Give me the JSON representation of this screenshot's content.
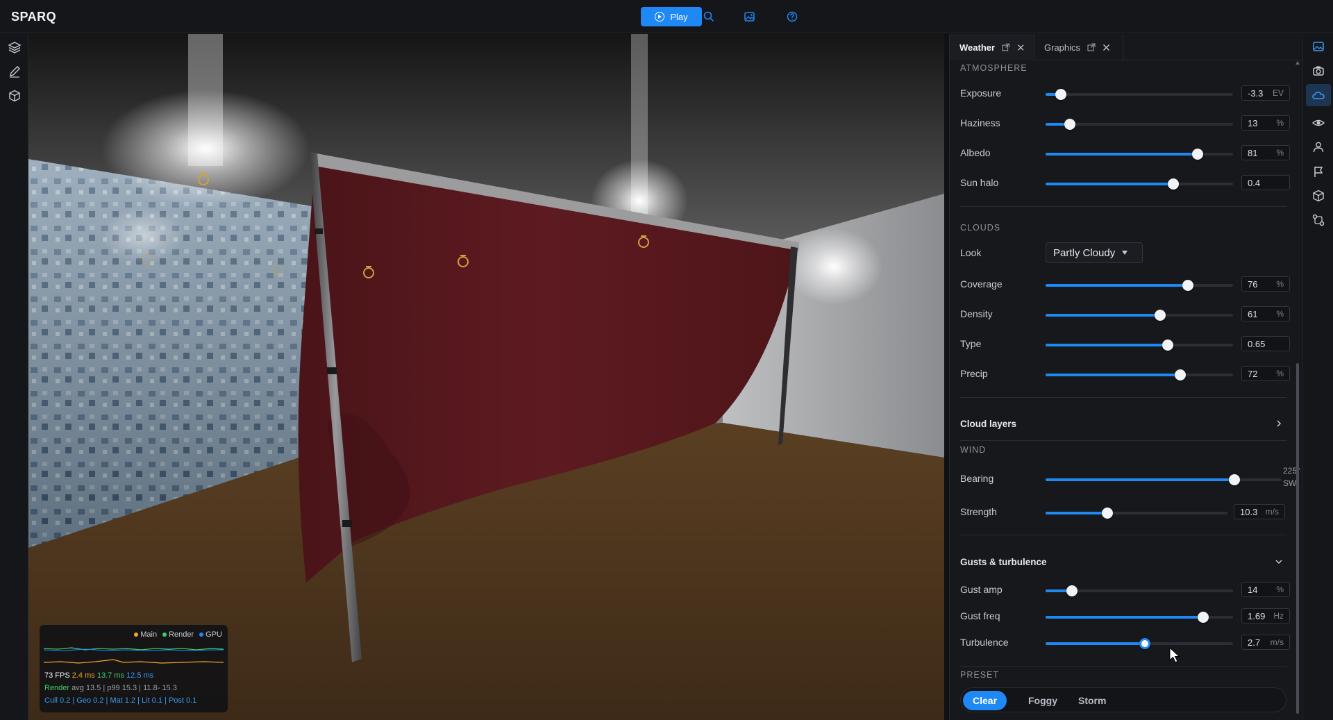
{
  "app": {
    "title": "SPARQ"
  },
  "toolbar": {
    "play_label": "Play"
  },
  "perf": {
    "legend": [
      "Main",
      "Render",
      "GPU"
    ],
    "fps": "73 FPS",
    "main_ms": "2.4 ms",
    "render_ms": "13.7 ms",
    "gpu_ms": "12.5 ms",
    "render_label": "Render",
    "render_stats": "avg 13.5 | p99 15.3 | 11.8- 15.3",
    "breakdown": "Cull 0.2 | Geo 0.2 | Mat 1.2 | Lit 0.1 | Post 0.1"
  },
  "tabs": [
    {
      "label": "Weather",
      "active": true
    },
    {
      "label": "Graphics",
      "active": false
    }
  ],
  "atmosphere": {
    "title": "ATMOSPHERE",
    "rows": [
      {
        "label": "Exposure",
        "value": "-3.3",
        "unit": "EV",
        "fraction": 0.08
      },
      {
        "label": "Haziness",
        "value": "13",
        "unit": "%",
        "fraction": 0.13
      },
      {
        "label": "Albedo",
        "value": "81",
        "unit": "%",
        "fraction": 0.81
      },
      {
        "label": "Sun halo",
        "value": "0.4",
        "unit": "",
        "fraction": 0.68
      }
    ]
  },
  "clouds": {
    "title": "CLOUDS",
    "look_label": "Look",
    "look_value": "Partly Cloudy",
    "rows": [
      {
        "label": "Coverage",
        "value": "76",
        "unit": "%",
        "fraction": 0.76
      },
      {
        "label": "Density",
        "value": "61",
        "unit": "%",
        "fraction": 0.61
      },
      {
        "label": "Type",
        "value": "0.65",
        "unit": "",
        "fraction": 0.65
      },
      {
        "label": "Precip",
        "value": "72",
        "unit": "%",
        "fraction": 0.72
      }
    ]
  },
  "cloud_layers": {
    "label": "Cloud layers"
  },
  "wind": {
    "title": "WIND",
    "bearing_label": "Bearing",
    "bearing_value": "225°",
    "bearing_dir": "SW",
    "bearing_fraction": 0.8,
    "strength_label": "Strength",
    "strength_value": "10.3",
    "strength_unit": "m/s",
    "strength_fraction": 0.34
  },
  "gusts": {
    "title": "Gusts & turbulence",
    "rows": [
      {
        "label": "Gust amp",
        "value": "14",
        "unit": "%",
        "fraction": 0.14
      },
      {
        "label": "Gust freq",
        "value": "1.69",
        "unit": "Hz",
        "fraction": 0.84
      },
      {
        "label": "Turbulence",
        "value": "2.7",
        "unit": "m/s",
        "fraction": 0.53
      }
    ]
  },
  "preset": {
    "title": "PRESET",
    "options": [
      "Clear",
      "Foggy",
      "Storm"
    ],
    "selected": "Clear"
  },
  "colors": {
    "accent": "#1e88f5",
    "panel": "#17181c",
    "curtain": "#5a1a1f"
  },
  "icons": {
    "top": [
      "play-icon",
      "search-icon",
      "image-edit-icon",
      "help-icon"
    ],
    "left": [
      "layers-icon",
      "pen-icon",
      "cube-icon"
    ],
    "rail": [
      "image-icon",
      "camera-icon",
      "cloud-icon",
      "eye-icon",
      "person-icon",
      "flag-icon",
      "cube-icon",
      "nodes-icon"
    ]
  }
}
